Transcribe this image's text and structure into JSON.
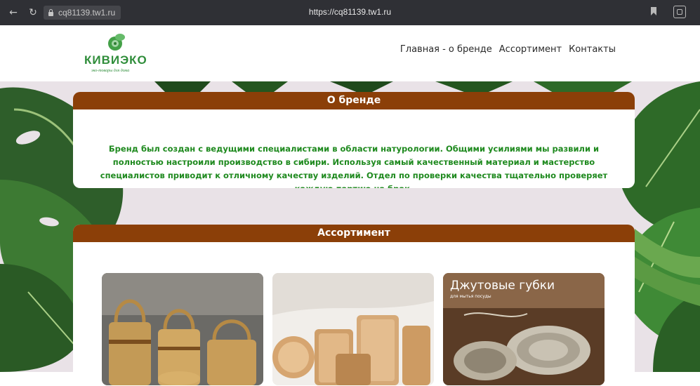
{
  "browser": {
    "site_short": "cq81139.tw1.ru",
    "url": "https://cq81139.tw1.ru",
    "icons": [
      "arrow-left-icon",
      "reload-icon",
      "lock-icon",
      "bookmark-icon",
      "extensions-icon"
    ]
  },
  "logo": {
    "text": "КИВИЭКО",
    "tagline": "эко-товары для дома"
  },
  "nav": [
    {
      "label": "Главная - о бренде"
    },
    {
      "label": "Ассортимент"
    },
    {
      "label": "Контакты"
    }
  ],
  "about": {
    "title": "О бренде",
    "text": "Бренд был создан с ведущими специалистами в области натурологии. Общими усилиями мы развили и полностью настроили производство в сибири. Используя самый качественный материал и мастерство специалистов приводит к отличному качеству изделий. Отдел по проверки качества тщательно проверяет каждую партию на брак."
  },
  "assortment": {
    "title": "Ассортимент",
    "cards": [
      {
        "image": "birch-bark-baskets"
      },
      {
        "image": "wooden-trays"
      },
      {
        "image": "jute-sponges",
        "title": "Джутовые губки",
        "subtitle": "для мытья посуды"
      }
    ]
  },
  "colors": {
    "header_brown": "#8b3f08",
    "text_green": "#1f8a1f",
    "logo_green": "#2f8d3a",
    "chrome": "#2f3035"
  }
}
